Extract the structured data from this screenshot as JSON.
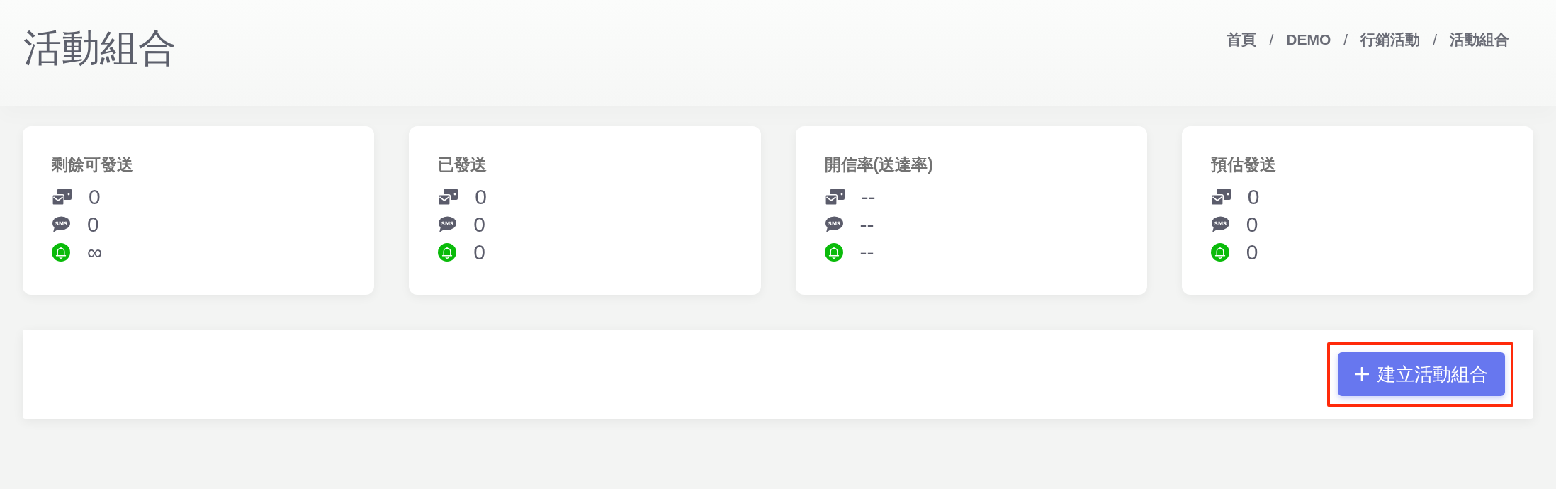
{
  "page": {
    "title": "活動組合"
  },
  "breadcrumb": [
    {
      "label": "首頁",
      "separator": "/"
    },
    {
      "label": "DEMO",
      "separator": "/"
    },
    {
      "label": "行銷活動",
      "separator": "/"
    },
    {
      "label": "活動組合"
    }
  ],
  "cards": [
    {
      "title": "剩餘可發送",
      "rows": [
        {
          "kind": "mail",
          "value": "0"
        },
        {
          "kind": "sms",
          "icon_text": "SMS",
          "value": "0"
        },
        {
          "kind": "notify",
          "value": "∞"
        }
      ]
    },
    {
      "title": "已發送",
      "rows": [
        {
          "kind": "mail",
          "value": "0"
        },
        {
          "kind": "sms",
          "icon_text": "SMS",
          "value": "0"
        },
        {
          "kind": "notify",
          "value": "0"
        }
      ]
    },
    {
      "title": "開信率(送達率)",
      "rows": [
        {
          "kind": "mail",
          "value": "--"
        },
        {
          "kind": "sms",
          "icon_text": "SMS",
          "value": "--"
        },
        {
          "kind": "notify",
          "value": "--"
        }
      ]
    },
    {
      "title": "預估發送",
      "rows": [
        {
          "kind": "mail",
          "value": "0"
        },
        {
          "kind": "sms",
          "icon_text": "SMS",
          "value": "0"
        },
        {
          "kind": "notify",
          "value": "0"
        }
      ]
    }
  ],
  "toolbar": {
    "button": {
      "label": "建立活動組合",
      "highlighted": true
    }
  }
}
